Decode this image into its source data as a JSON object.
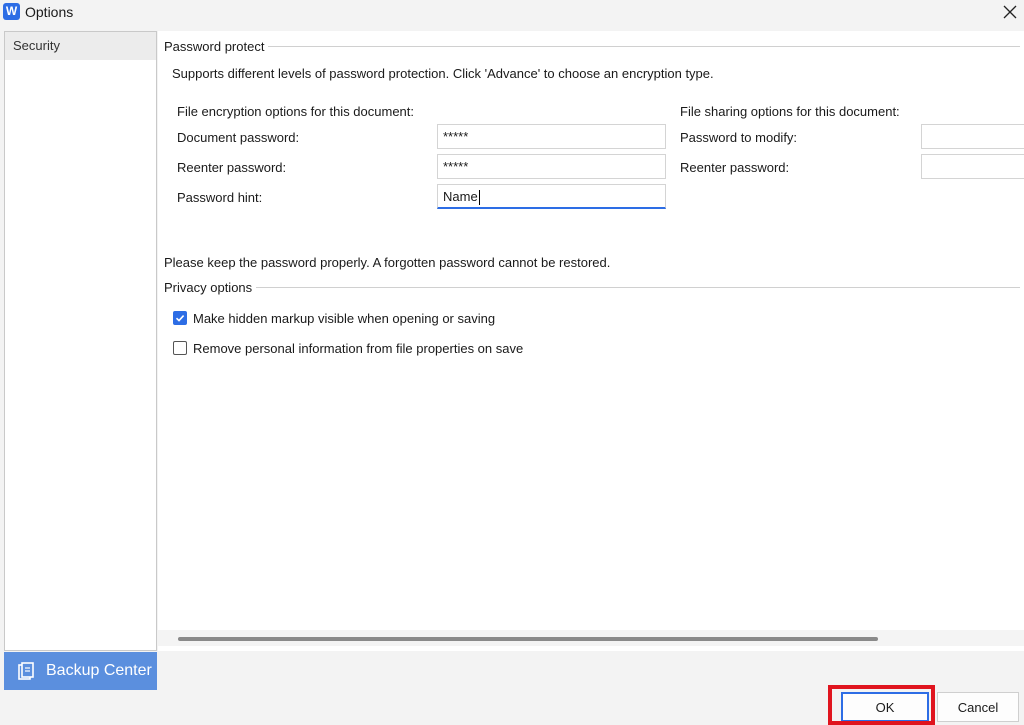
{
  "window": {
    "app_icon_letter": "W",
    "title": "Options",
    "close_icon": "close-icon"
  },
  "sidebar": {
    "items": [
      {
        "label": "Security",
        "selected": true
      }
    ],
    "backup_center": {
      "label": "Backup Center",
      "icon": "backup-icon"
    }
  },
  "password_protect": {
    "section_title": "Password protect",
    "description": "Supports different levels of password protection. Click 'Advance' to choose an encryption type.",
    "encryption": {
      "heading": "File encryption options for this document:",
      "document_password_label": "Document password:",
      "document_password_value": "*****",
      "reenter_password_label": "Reenter password:",
      "reenter_password_value": "*****",
      "hint_label": "Password hint:",
      "hint_value": "Name"
    },
    "sharing": {
      "heading": "File sharing options for this document:",
      "modify_label": "Password to modify:",
      "modify_value": "",
      "reenter_label": "Reenter password:",
      "reenter_value": ""
    },
    "warning": "Please keep the password properly. A forgotten password cannot be restored."
  },
  "privacy": {
    "section_title": "Privacy options",
    "options": [
      {
        "label": "Make hidden markup visible when opening or saving",
        "checked": true
      },
      {
        "label": "Remove personal information from file properties on save",
        "checked": false
      }
    ]
  },
  "buttons": {
    "ok": "OK",
    "cancel": "Cancel"
  },
  "colors": {
    "accent": "#2d6de5",
    "highlight": "#e0141e",
    "backup_center_bg": "#5b8fde"
  }
}
